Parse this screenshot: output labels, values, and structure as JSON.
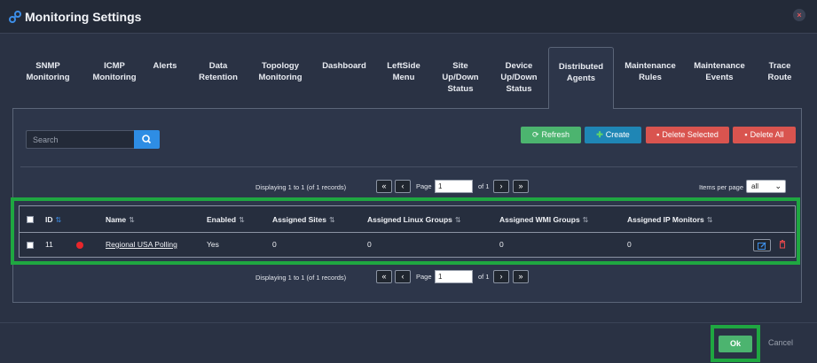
{
  "window": {
    "title": "Monitoring Settings",
    "close_label": "×",
    "title_icon": "link-icon"
  },
  "tabs": [
    {
      "label": "SNMP\nMonitoring",
      "active": false
    },
    {
      "label": "ICMP\nMonitoring",
      "active": false
    },
    {
      "label": "Alerts",
      "active": false
    },
    {
      "label": "Data\nRetention",
      "active": false
    },
    {
      "label": "Topology\nMonitoring",
      "active": false
    },
    {
      "label": "Dashboard",
      "active": false
    },
    {
      "label": "LeftSide\nMenu",
      "active": false
    },
    {
      "label": "Site\nUp/Down\nStatus",
      "active": false
    },
    {
      "label": "Device\nUp/Down\nStatus",
      "active": false
    },
    {
      "label": "Distributed\nAgents",
      "active": true
    },
    {
      "label": "Maintenance\nRules",
      "active": false
    },
    {
      "label": "Maintenance\nEvents",
      "active": false
    },
    {
      "label": "Trace\nRoute",
      "active": false
    }
  ],
  "toolbar": {
    "search_placeholder": "Search",
    "refresh_label": "Refresh",
    "create_label": "Create",
    "delete_selected_label": "Delete Selected",
    "delete_all_label": "Delete All"
  },
  "pagination": {
    "display_text": "Displaying 1 to 1 (of 1 records)",
    "page_label": "Page",
    "page_value": "1",
    "of_label": "of 1",
    "first_glyph": "«",
    "prev_glyph": "‹",
    "next_glyph": "›",
    "last_glyph": "»",
    "items_per_page_label": "Items per page",
    "items_per_page_value": "all"
  },
  "table": {
    "columns": {
      "id": "ID",
      "name": "Name",
      "enabled": "Enabled",
      "sites": "Assigned Sites",
      "linux": "Assigned Linux Groups",
      "wmi": "Assigned WMI Groups",
      "ip": "Assigned IP Monitors"
    },
    "rows": [
      {
        "id": "11",
        "status": "offline",
        "name": "Regional USA Polling",
        "enabled": "Yes",
        "sites": "0",
        "linux": "0",
        "wmi": "0",
        "ip": "0"
      }
    ]
  },
  "footer": {
    "ok_label": "Ok",
    "cancel_label": "Cancel"
  },
  "colors": {
    "highlight": "#1fa741",
    "status_offline": "#e8262b",
    "accent": "#2e8de4"
  }
}
